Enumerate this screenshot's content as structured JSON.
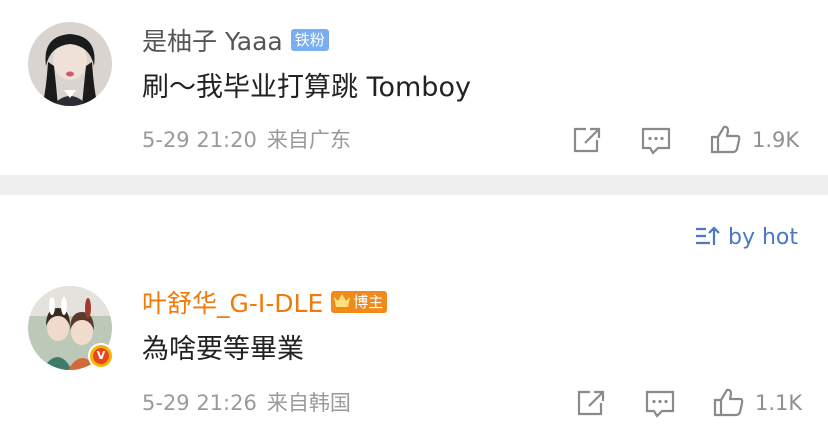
{
  "comments": [
    {
      "username": "是柚子 Yaaa",
      "badge": "铁粉",
      "text": "刷～我毕业打算跳 Tomboy",
      "date": "5-29 21:20",
      "location": "来自广东",
      "likes": "1.9K"
    },
    {
      "username": "叶舒华_G-I-DLE",
      "badge": "博主",
      "text": "為啥要等畢業",
      "date": "5-29 21:26",
      "location": "来自韩国",
      "likes": "1.1K"
    }
  ],
  "sort": {
    "label": "by hot"
  },
  "colors": {
    "username_default": "#555555",
    "username_vip": "#f07a0a",
    "fan_badge": "#7aaef0",
    "host_badge": "#f08a1a",
    "link": "#4a78c2"
  },
  "icons": [
    "share-icon",
    "comment-icon",
    "like-icon",
    "sort-icon",
    "verified-icon"
  ]
}
